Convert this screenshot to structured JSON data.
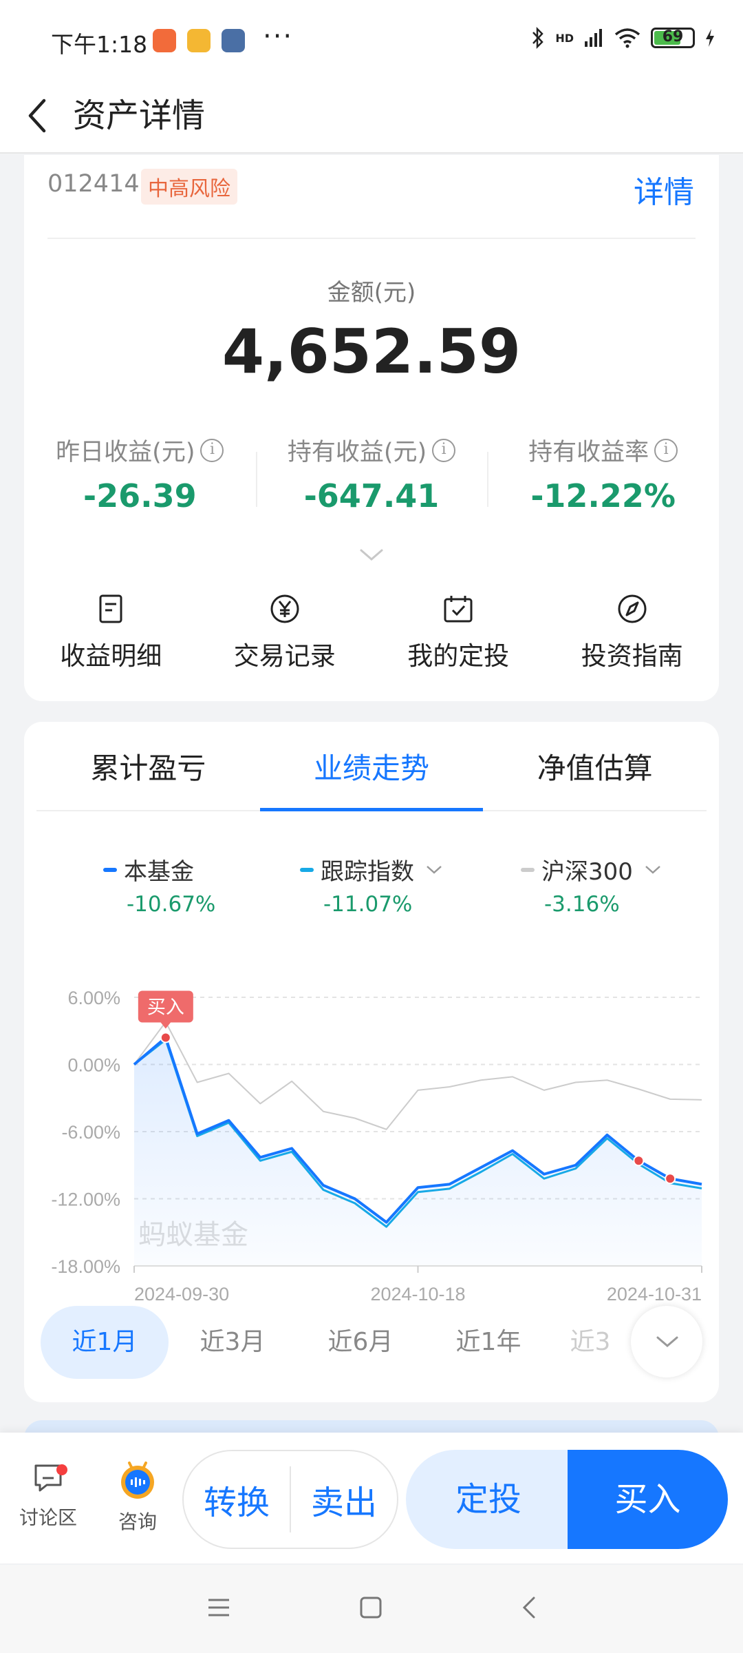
{
  "status_bar": {
    "time": "下午1:18",
    "battery": "69",
    "more": "···",
    "network": "HD"
  },
  "nav": {
    "title": "资产详情"
  },
  "fund": {
    "code": "012414",
    "risk": "中高风险",
    "detail_link": "详情",
    "amount_label": "金额(元)",
    "amount": "4,652.59",
    "metrics": [
      {
        "label": "昨日收益(元)",
        "value": "-26.39"
      },
      {
        "label": "持有收益(元)",
        "value": "-647.41"
      },
      {
        "label": "持有收益率",
        "value": "-12.22%"
      }
    ],
    "quick_actions": [
      {
        "label": "收益明细",
        "icon": "document-icon"
      },
      {
        "label": "交易记录",
        "icon": "yen-circle-icon"
      },
      {
        "label": "我的定投",
        "icon": "calendar-check-icon"
      },
      {
        "label": "投资指南",
        "icon": "compass-icon"
      }
    ]
  },
  "chart_tabs": [
    {
      "label": "累计盈亏",
      "active": false
    },
    {
      "label": "业绩走势",
      "active": true
    },
    {
      "label": "净值估算",
      "active": false
    }
  ],
  "legend": [
    {
      "name": "本基金",
      "value": "-10.67%",
      "color": "#1677ff",
      "dropdown": false
    },
    {
      "name": "跟踪指数",
      "value": "-11.07%",
      "color": "#17a9e6",
      "dropdown": true
    },
    {
      "name": "沪深300",
      "value": "-3.16%",
      "color": "#cccccc",
      "dropdown": true
    }
  ],
  "chart_data": {
    "type": "line",
    "x_labels": [
      "2024-09-30",
      "2024-10-18",
      "2024-10-31"
    ],
    "y_ticks": [
      "6.00%",
      "0.00%",
      "-6.00%",
      "-12.00%",
      "-18.00%"
    ],
    "ylim": [
      -18,
      6
    ],
    "buy_marker_label": "买入",
    "watermark": "蚂蚁基金",
    "series": [
      {
        "name": "本基金",
        "color": "#1677ff",
        "values": [
          0.0,
          2.4,
          -6.2,
          -5.0,
          -8.3,
          -7.5,
          -10.8,
          -12.0,
          -14.1,
          -11.0,
          -10.7,
          -9.2,
          -7.7,
          -9.8,
          -9.0,
          -6.3,
          -8.6,
          -10.2,
          -10.7
        ]
      },
      {
        "name": "跟踪指数",
        "color": "#17a9e6",
        "values": [
          0.0,
          2.2,
          -6.4,
          -5.2,
          -8.6,
          -7.8,
          -11.2,
          -12.4,
          -14.5,
          -11.4,
          -11.1,
          -9.6,
          -8.0,
          -10.2,
          -9.3,
          -6.6,
          -8.9,
          -10.6,
          -11.07
        ]
      },
      {
        "name": "沪深300",
        "color": "#cccccc",
        "values": [
          0.0,
          3.8,
          -1.6,
          -0.8,
          -3.5,
          -1.5,
          -4.2,
          -4.8,
          -5.8,
          -2.3,
          -2.0,
          -1.4,
          -1.1,
          -2.3,
          -1.6,
          -1.4,
          -2.2,
          -3.1,
          -3.16
        ]
      }
    ],
    "buy_index": 1,
    "markers": [
      1,
      16,
      17
    ]
  },
  "periods": [
    {
      "label": "近1月",
      "active": true
    },
    {
      "label": "近3月",
      "active": false
    },
    {
      "label": "近6月",
      "active": false
    },
    {
      "label": "近1年",
      "active": false
    },
    {
      "label": "近3",
      "active": false
    }
  ],
  "action_bar": {
    "forum": "讨论区",
    "consult": "咨询",
    "convert": "转换",
    "sell": "卖出",
    "sip": "定投",
    "buy": "买入"
  },
  "colors": {
    "accent": "#1677ff",
    "loss": "#1a9a6c",
    "risk": "#e8663d"
  }
}
